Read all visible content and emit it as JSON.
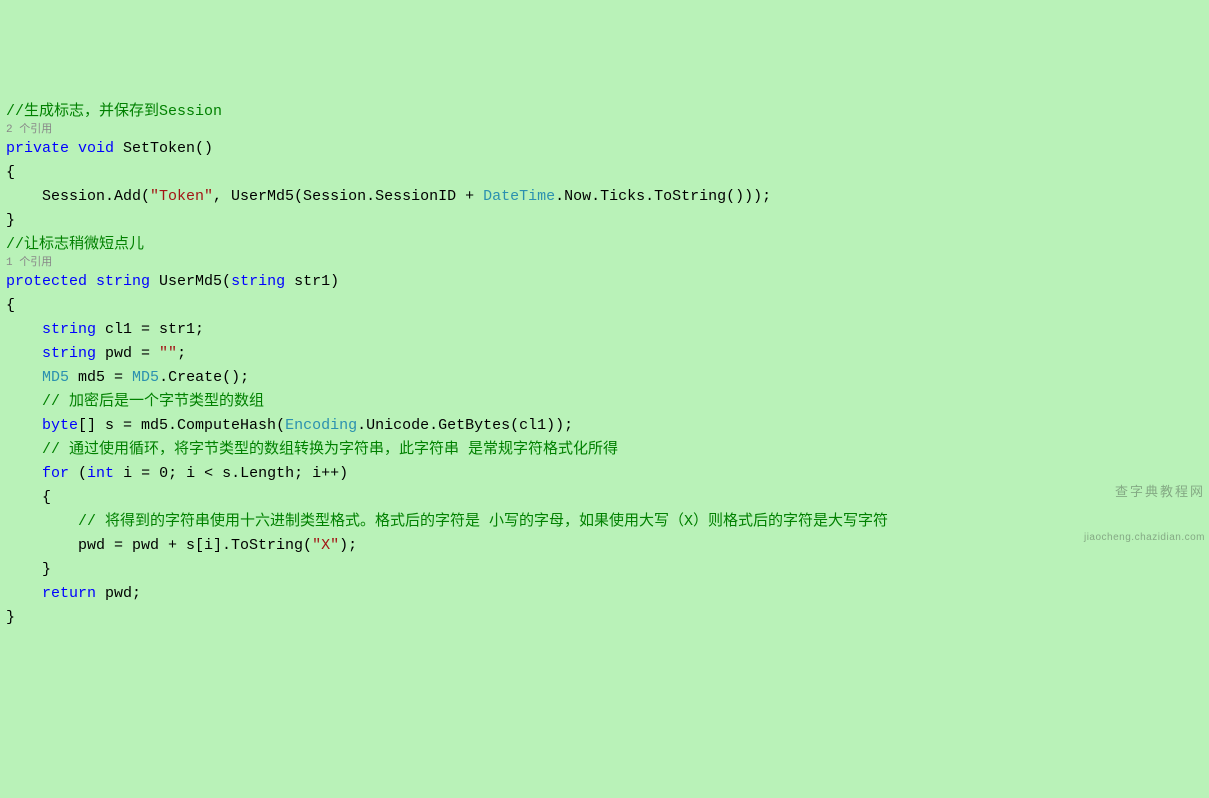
{
  "code": {
    "line1_comment": "//生成标志，并保存到Session",
    "ref1": "2 个引用",
    "line2_kw1": "private",
    "line2_kw2": "void",
    "line2_method": " SetToken()",
    "line3": "{",
    "line4a": "    Session.Add(",
    "line4_str": "\"Token\"",
    "line4b": ", UserMd5(Session.SessionID + ",
    "line4_type": "DateTime",
    "line4c": ".Now.Ticks.ToString()));",
    "line5": "}",
    "blank": "",
    "line6_comment": "//让标志稍微短点儿",
    "ref2": "1 个引用",
    "line7_kw1": "protected",
    "line7_kw2": "string",
    "line7_method": " UserMd5(",
    "line7_kw3": "string",
    "line7_param": " str1)",
    "line8": "{",
    "line9a": "    ",
    "line9_kw": "string",
    "line9b": " cl1 = str1;",
    "line10a": "    ",
    "line10_kw": "string",
    "line10b": " pwd = ",
    "line10_str": "\"\"",
    "line10c": ";",
    "line11a": "    ",
    "line11_type1": "MD5",
    "line11b": " md5 = ",
    "line11_type2": "MD5",
    "line11c": ".Create();",
    "line12_comment": "    // 加密后是一个字节类型的数组",
    "line13a": "    ",
    "line13_kw": "byte",
    "line13b": "[] s = md5.ComputeHash(",
    "line13_type": "Encoding",
    "line13c": ".Unicode.GetBytes(cl1));",
    "line14_comment": "    // 通过使用循环，将字节类型的数组转换为字符串，此字符串 是常规字符格式化所得",
    "line15a": "    ",
    "line15_kw1": "for",
    "line15b": " (",
    "line15_kw2": "int",
    "line15c": " i = 0; i < s.Length; i++)",
    "line16": "    {",
    "line17_comment": "        // 将得到的字符串使用十六进制类型格式。格式后的字符是 小写的字母，如果使用大写（X）则格式后的字符是大写字符",
    "line18a": "        pwd = pwd + s[i].ToString(",
    "line18_str": "\"X\"",
    "line18b": ");",
    "line19": "    }",
    "line20a": "    ",
    "line20_kw": "return",
    "line20b": " pwd;",
    "line21": "}"
  },
  "watermark": {
    "main": "查字典教程网",
    "sub": "jiaocheng.chazidian.com"
  }
}
